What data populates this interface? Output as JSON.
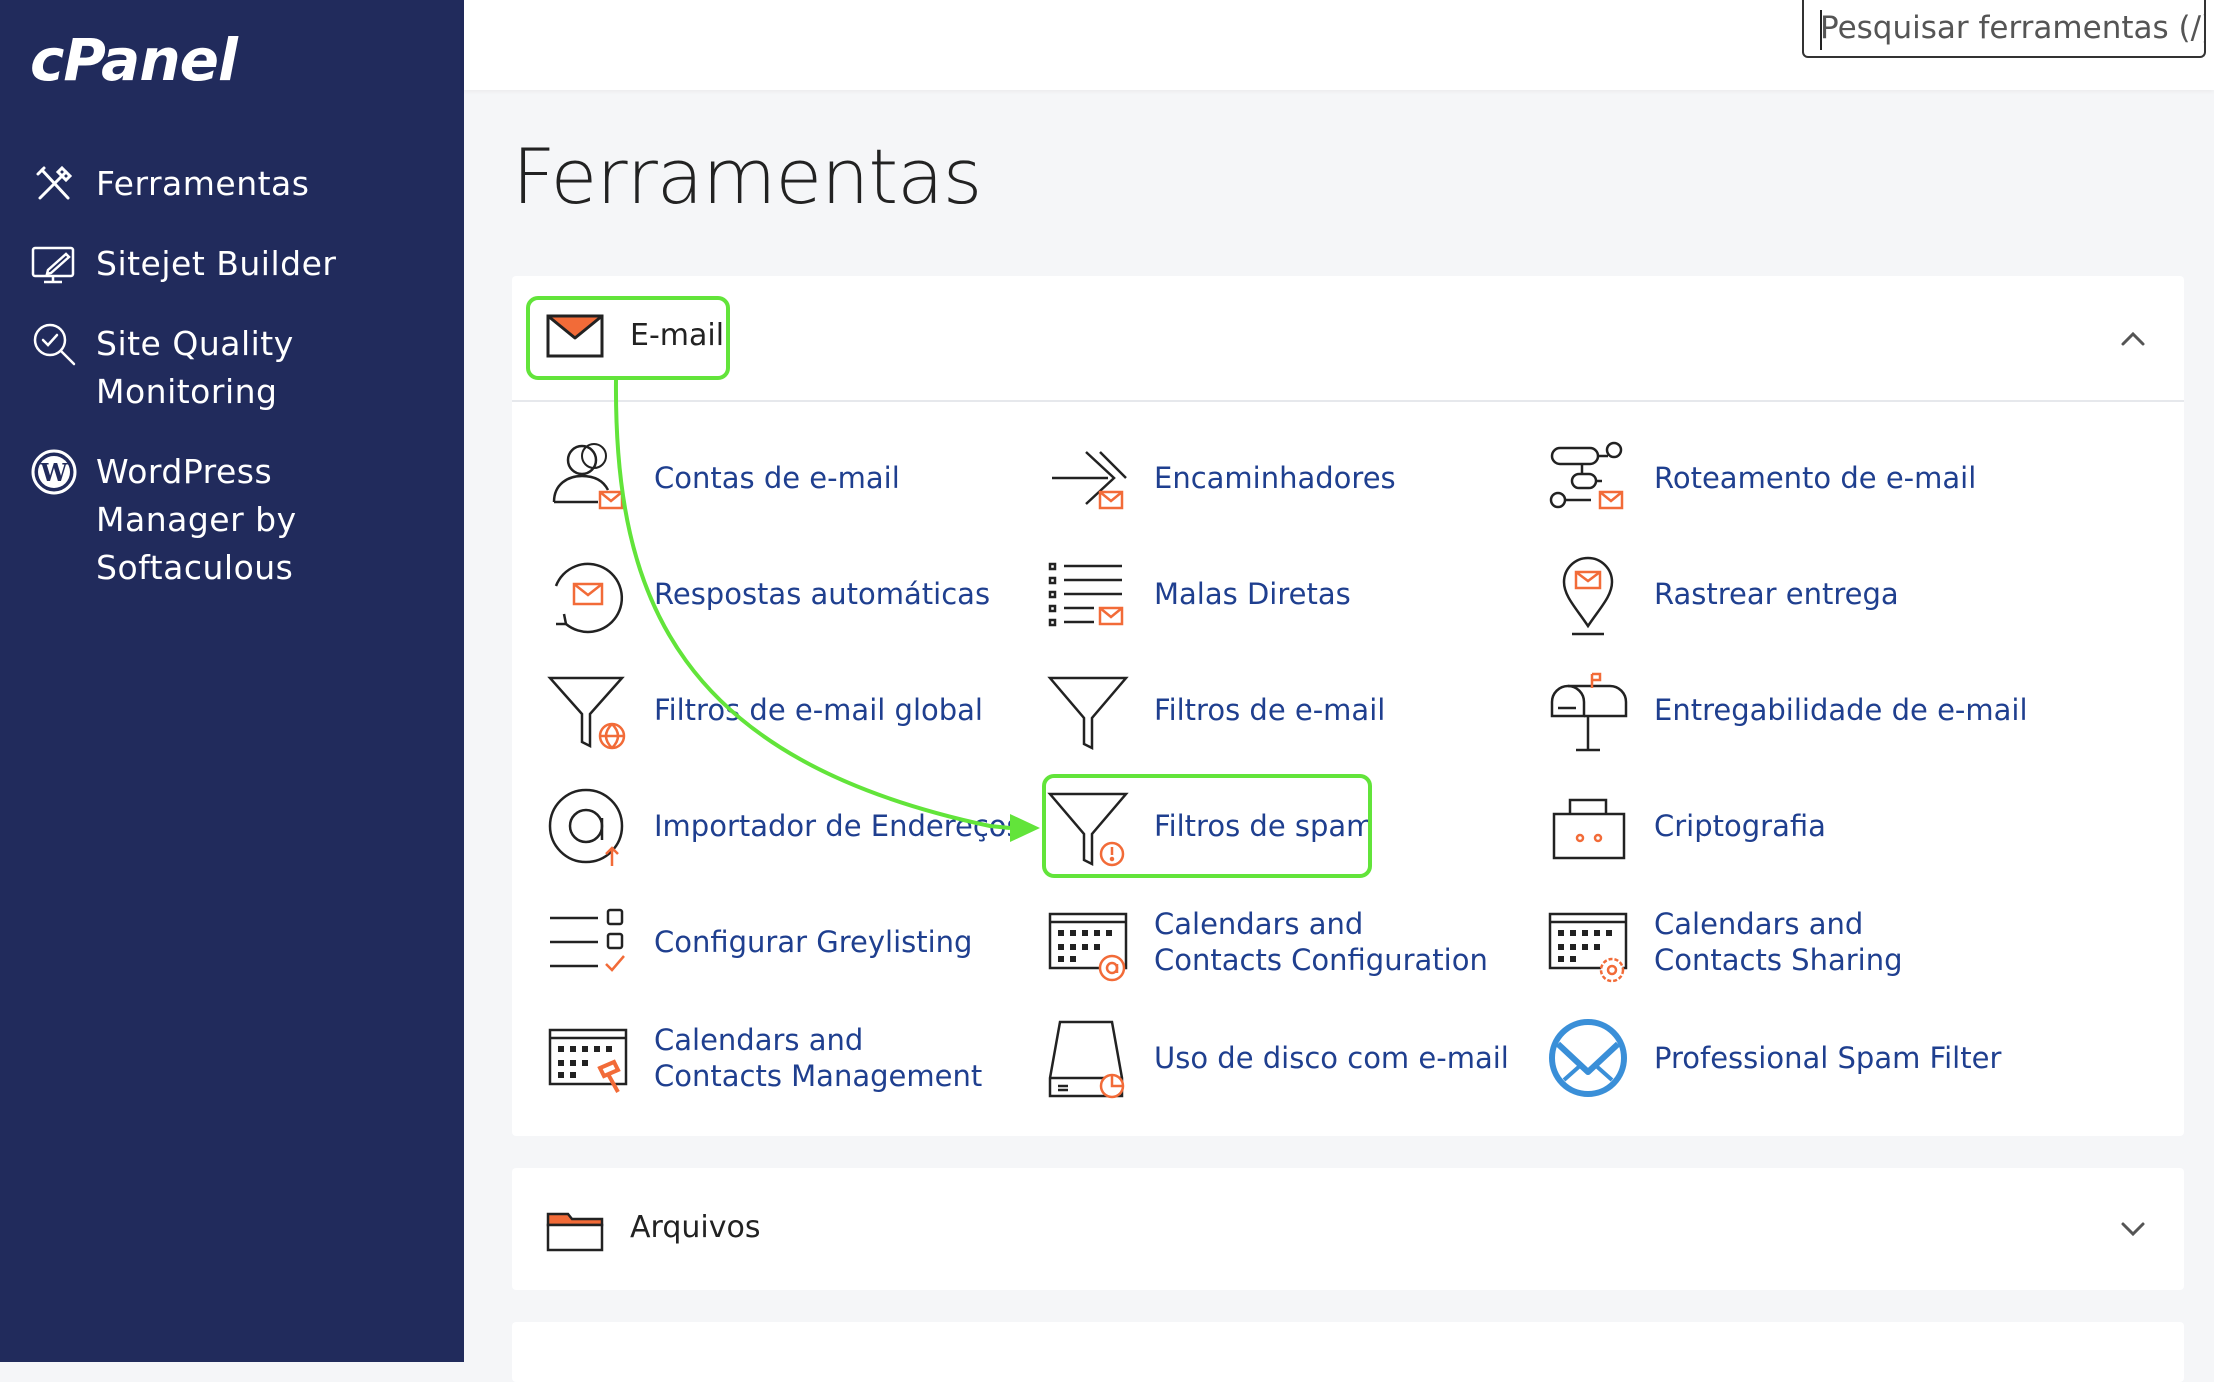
{
  "brand": {
    "logo": "cPanel"
  },
  "sidebar": {
    "items": [
      {
        "label": "Ferramentas",
        "icon": "tools-icon"
      },
      {
        "label": "Sitejet Builder",
        "icon": "monitor-pen-icon"
      },
      {
        "label": "Site Quality Monitoring",
        "icon": "magnifier-check-icon"
      },
      {
        "label": "WordPress Manager by Softaculous",
        "icon": "wordpress-icon"
      }
    ]
  },
  "search": {
    "placeholder": "Pesquisar ferramentas (/)",
    "value": ""
  },
  "page": {
    "title": "Ferramentas"
  },
  "sections": {
    "email": {
      "title": "E-mail",
      "tools": [
        {
          "label": "Contas de e-mail",
          "icon": "user-envelope-icon"
        },
        {
          "label": "Encaminhadores",
          "icon": "forward-arrow-icon"
        },
        {
          "label": "Roteamento de e-mail",
          "icon": "routing-icon"
        },
        {
          "label": "Respostas automáticas",
          "icon": "autoresponder-icon"
        },
        {
          "label": "Malas Diretas",
          "icon": "mailing-list-icon"
        },
        {
          "label": "Rastrear entrega",
          "icon": "location-pin-icon"
        },
        {
          "label": "Filtros de e-mail global",
          "icon": "filter-globe-icon"
        },
        {
          "label": "Filtros de e-mail",
          "icon": "filter-icon"
        },
        {
          "label": "Entregabilidade de e-mail",
          "icon": "mailbox-icon"
        },
        {
          "label": "Importador de Endereços",
          "icon": "at-sign-icon"
        },
        {
          "label": "Filtros de spam",
          "icon": "filter-alert-icon"
        },
        {
          "label": "Criptografia",
          "icon": "lock-box-icon"
        },
        {
          "label": "Configurar Greylisting",
          "icon": "checklist-icon"
        },
        {
          "label": "Calendars and Contacts Configuration",
          "icon": "calendar-at-icon"
        },
        {
          "label": "Calendars and Contacts Sharing",
          "icon": "calendar-gear-icon"
        },
        {
          "label": "Calendars and Contacts Management",
          "icon": "calendar-hammer-icon"
        },
        {
          "label": "Uso de disco com e-mail",
          "icon": "disk-chart-icon"
        },
        {
          "label": "Professional Spam Filter",
          "icon": "spam-filter-logo-icon"
        }
      ]
    },
    "files": {
      "title": "Arquivos"
    }
  },
  "colors": {
    "sidebar": "#212b5c",
    "link": "#1f3f8f",
    "accent": "#f26b38",
    "highlight": "#62e43a"
  }
}
